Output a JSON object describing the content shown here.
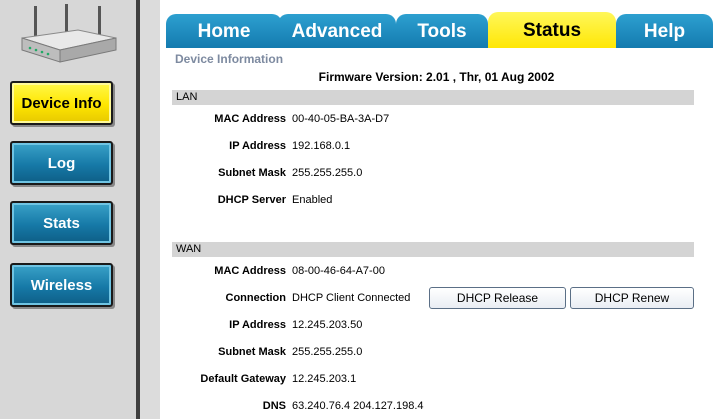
{
  "sidebar": {
    "items": [
      {
        "label": "Device Info",
        "active": true
      },
      {
        "label": "Log"
      },
      {
        "label": "Stats"
      },
      {
        "label": "Wireless"
      }
    ]
  },
  "tabs": [
    {
      "label": "Home"
    },
    {
      "label": "Advanced"
    },
    {
      "label": "Tools"
    },
    {
      "label": "Status",
      "active": true
    },
    {
      "label": "Help"
    }
  ],
  "content": {
    "section_title": "Device Information",
    "firmware": "Firmware Version: 2.01 , Thr, 01 Aug 2002",
    "lan": {
      "header": "LAN",
      "rows": [
        {
          "label": "MAC Address",
          "value": "00-40-05-BA-3A-D7"
        },
        {
          "label": "IP Address",
          "value": "192.168.0.1"
        },
        {
          "label": "Subnet Mask",
          "value": "255.255.255.0"
        },
        {
          "label": "DHCP Server",
          "value": "Enabled"
        }
      ]
    },
    "wan": {
      "header": "WAN",
      "rows": [
        {
          "label": "MAC Address",
          "value": "08-00-46-64-A7-00"
        },
        {
          "label": "Connection",
          "value": "DHCP Client Connected"
        },
        {
          "label": "IP Address",
          "value": "12.245.203.50"
        },
        {
          "label": "Subnet Mask",
          "value": "255.255.255.0"
        },
        {
          "label": "Default Gateway",
          "value": "12.245.203.1"
        },
        {
          "label": "DNS",
          "value": "63.240.76.4 204.127.198.4"
        }
      ],
      "buttons": {
        "release": "DHCP Release",
        "renew": "DHCP Renew"
      }
    }
  },
  "colors": {
    "tab_blue": "#1a86bb",
    "active_yellow": "#ffee00",
    "sidebar_bg": "#d7d7d7",
    "band_gray": "#d4d4d4",
    "caption_gray": "#7d8aa0"
  },
  "icons": [
    "router-icon"
  ]
}
